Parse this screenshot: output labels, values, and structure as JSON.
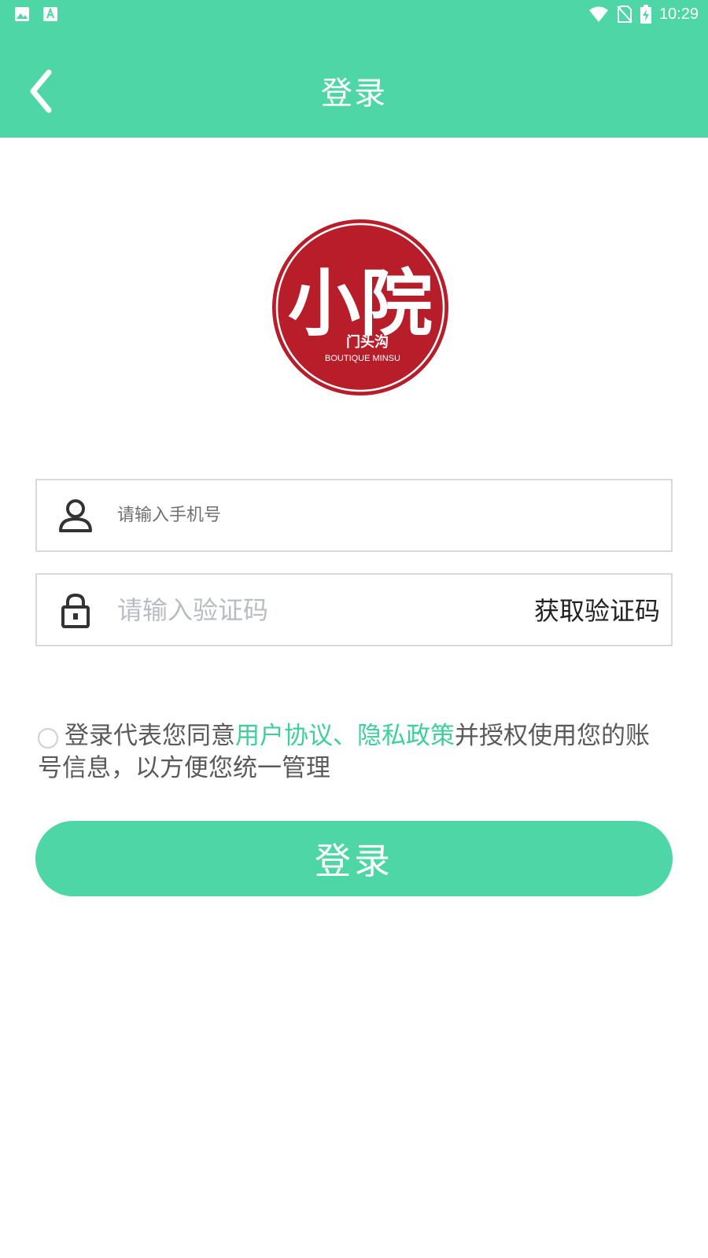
{
  "status_bar": {
    "time": "10:29",
    "left_icons": [
      "image-icon",
      "font-a-icon"
    ],
    "right_icons": [
      "wifi-icon",
      "no-sim-icon",
      "battery-charging-icon"
    ]
  },
  "header": {
    "title": "登录",
    "back_icon": "chevron-left-icon"
  },
  "logo": {
    "main_text": "小院",
    "sub_text": "门头沟",
    "en_text": "BOUTIQUE MINSU",
    "color": "#b81d2a"
  },
  "form": {
    "phone_placeholder": "请输入手机号",
    "code_placeholder": "请输入验证码",
    "get_code_label": "获取验证码"
  },
  "agreement": {
    "prefix": "登录代表您同意",
    "user_agreement": "用户协议",
    "separator": "、",
    "privacy_policy": "隐私政策",
    "suffix": "并授权使用您的账号信息，以方便您统一管理"
  },
  "login_button": "登录",
  "colors": {
    "accent": "#4fd6a6",
    "link": "#3fcf9a",
    "logo_red": "#b81d2a"
  }
}
